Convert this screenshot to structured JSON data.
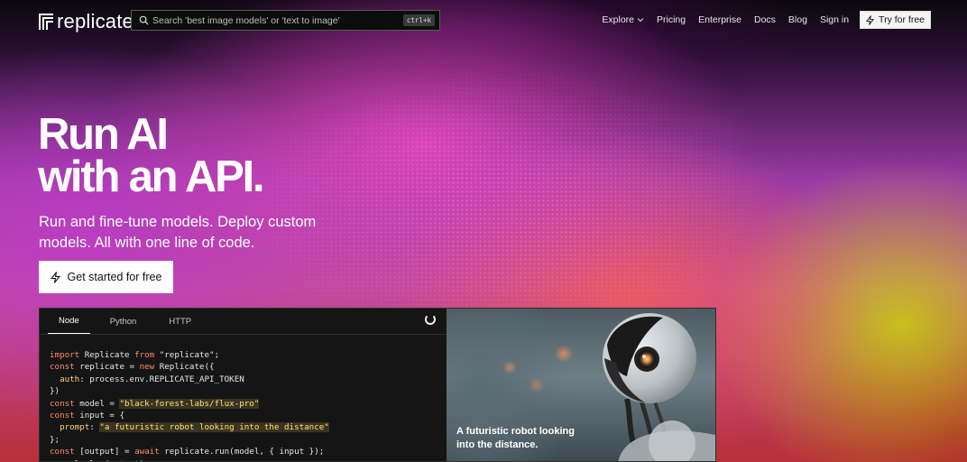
{
  "brand": {
    "name": "replicate"
  },
  "search": {
    "placeholder": "Search 'best image models' or 'text to image'",
    "shortcut": "ctrl+k"
  },
  "nav": {
    "explore": "Explore",
    "pricing": "Pricing",
    "enterprise": "Enterprise",
    "docs": "Docs",
    "blog": "Blog",
    "sign_in": "Sign in",
    "try_free": "Try for free"
  },
  "hero": {
    "title_line1": "Run AI",
    "title_line2": "with an API.",
    "subtitle": "Run and fine-tune models. Deploy custom models. All with one line of code.",
    "cta": "Get started for free"
  },
  "code_panel": {
    "tabs": [
      "Node",
      "Python",
      "HTTP"
    ],
    "active_tab": "Node",
    "lines": [
      "import Replicate from \"replicate\";",
      "const replicate = new Replicate({",
      "  auth: process.env.REPLICATE_API_TOKEN",
      "})",
      "const model = \"black-forest-labs/flux-pro\"",
      "const input = {",
      "  prompt: \"a futuristic robot looking into the distance\"",
      "};",
      "const [output] = await replicate.run(model, { input });",
      "console.log(output);"
    ],
    "image_caption": "A futuristic robot looking into the distance."
  },
  "icons": {
    "search": "search-icon",
    "bolt": "lightning-bolt-icon",
    "chevron": "chevron-down-icon",
    "spinner": "loading-spinner-icon"
  },
  "colors": {
    "keyword": "#ff8a6b",
    "string": "#ffe27a",
    "cta_bg": "#ffffff",
    "nav_bg": "#0b080d"
  }
}
